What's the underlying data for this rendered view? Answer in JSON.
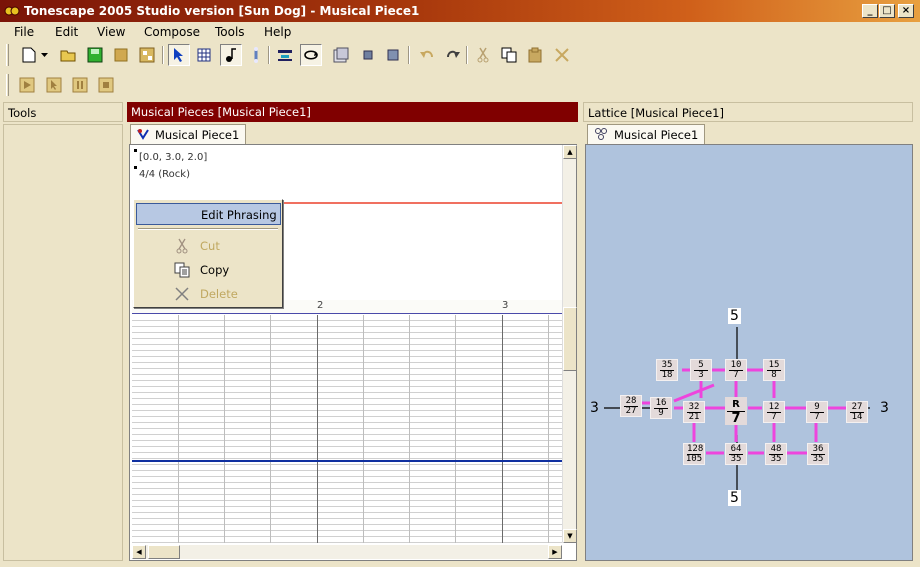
{
  "window": {
    "title": "Tonescape 2005 Studio  version [Sun Dog]  -  Musical Piece1",
    "minimize": "_",
    "maximize": "□",
    "close": "×"
  },
  "menu": [
    "File",
    "Edit",
    "View",
    "Compose",
    "Tools",
    "Help"
  ],
  "panes": {
    "tools": {
      "title": "Tools"
    },
    "pieces": {
      "title": "Musical Pieces  [Musical Piece1]",
      "tab": "Musical Piece1",
      "info_line1": "[0.0, 3.0, 2.0]",
      "info_line2": "4/4 (Rock)",
      "measures": [
        "2",
        "3"
      ]
    },
    "lattice": {
      "title": "Lattice  [Musical Piece1]",
      "tab": "Musical Piece1",
      "top_label": "5",
      "bottom_label": "5",
      "left_label": "3",
      "right_label": "3",
      "center": {
        "num": "R",
        "den": "7"
      },
      "nodes": [
        {
          "num": "35",
          "den": "18"
        },
        {
          "num": "5",
          "den": "3"
        },
        {
          "num": "10",
          "den": "7"
        },
        {
          "num": "15",
          "den": "8"
        },
        {
          "num": "28",
          "den": "27"
        },
        {
          "num": "16",
          "den": "9"
        },
        {
          "num": "32",
          "den": "21"
        },
        {
          "num": "12",
          "den": "7"
        },
        {
          "num": "9",
          "den": "7"
        },
        {
          "num": "27",
          "den": "14"
        },
        {
          "num": "128",
          "den": "105"
        },
        {
          "num": "64",
          "den": "35"
        },
        {
          "num": "48",
          "den": "35"
        },
        {
          "num": "36",
          "den": "35"
        }
      ]
    }
  },
  "context_menu": {
    "items": [
      {
        "label": "Edit Phrasing",
        "enabled": true
      },
      {
        "label": "Cut",
        "enabled": false
      },
      {
        "label": "Copy",
        "enabled": true
      },
      {
        "label": "Delete",
        "enabled": false
      }
    ]
  },
  "colors": {
    "pieces_header": "#800000",
    "lattice_bg": "#AFC3DD",
    "lattice_link": "#EE44DD",
    "menu_highlight": "#B7C8E3"
  }
}
